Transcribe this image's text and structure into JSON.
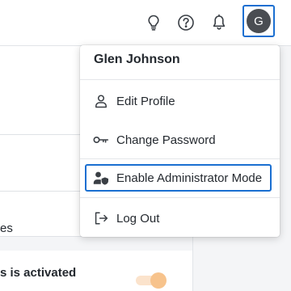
{
  "topbar": {
    "icons": [
      "lightbulb-icon",
      "help-icon",
      "bell-icon"
    ],
    "avatar_initial": "G"
  },
  "background": {
    "row_text_1": "es",
    "row_text_2": "s is activated"
  },
  "user_menu": {
    "name": "Glen Johnson",
    "items": [
      {
        "label": "Edit Profile",
        "icon": "user-icon"
      },
      {
        "label": "Change Password",
        "icon": "key-icon"
      },
      {
        "label": "Enable Administrator Mode",
        "icon": "user-shield-icon"
      },
      {
        "label": "Log Out",
        "icon": "logout-icon"
      }
    ]
  },
  "colors": {
    "focus_ring": "#1a6fd1",
    "avatar_bg": "#4a4d52",
    "toggle_track": "#fbe3cc",
    "toggle_knob": "#f7c38c"
  }
}
